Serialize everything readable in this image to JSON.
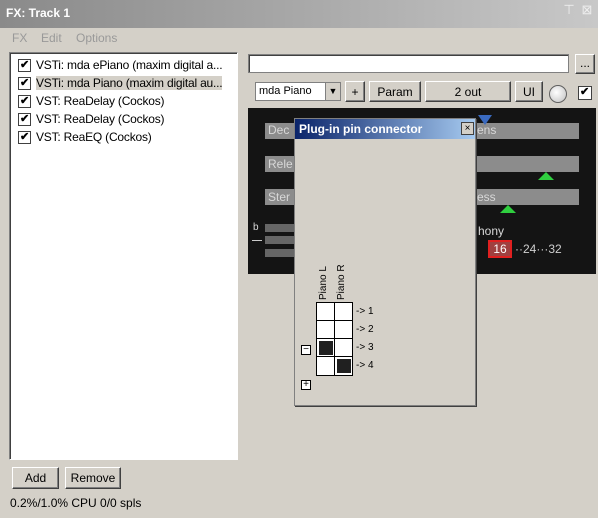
{
  "window": {
    "title": "FX: Track 1",
    "pin_glyph": "⊤",
    "close_glyph": "⊠"
  },
  "menu": {
    "items": [
      "FX",
      "Edit",
      "Options"
    ]
  },
  "fx_list": {
    "items": [
      {
        "label": "VSTi: mda ePiano (maxim digital a...",
        "checked": true,
        "selected": false
      },
      {
        "label": "VSTi: mda Piano (maxim digital au...",
        "checked": true,
        "selected": true
      },
      {
        "label": "VST: ReaDelay (Cockos)",
        "checked": true,
        "selected": false
      },
      {
        "label": "VST: ReaDelay (Cockos)",
        "checked": true,
        "selected": false
      },
      {
        "label": "VST: ReaEQ (Cockos)",
        "checked": true,
        "selected": false
      }
    ]
  },
  "buttons": {
    "add": "Add",
    "remove": "Remove"
  },
  "status": {
    "cpu": "0.2%/1.0% CPU 0/0 spls"
  },
  "toolbar": {
    "preset_value": "",
    "browse_label": "...",
    "preset_select": "mda Piano",
    "plus_label": "+",
    "param_label": "Param",
    "out_label": "2 out",
    "ui_label": "UI",
    "bypass_checked": true
  },
  "plugin_ui": {
    "labels": {
      "decay": "Dec",
      "decay_right": "ens",
      "release": "Rele",
      "stereo": "Ster",
      "stereo_right": "ess",
      "polyphony": "hony",
      "b_mark": "b"
    },
    "polyphony_scale": {
      "current": "16",
      "rest": "··24···32"
    }
  },
  "pin_connector": {
    "title": "Plug-in pin connector",
    "close_glyph": "×",
    "inputs": [
      "Piano L",
      "Piano R"
    ],
    "outputs": [
      "-> 1",
      "-> 2",
      "-> 3",
      "-> 4"
    ],
    "matrix": [
      [
        false,
        false
      ],
      [
        false,
        false
      ],
      [
        true,
        false
      ],
      [
        false,
        true
      ]
    ],
    "collapse_glyph": "−",
    "expand_glyph": "+"
  }
}
